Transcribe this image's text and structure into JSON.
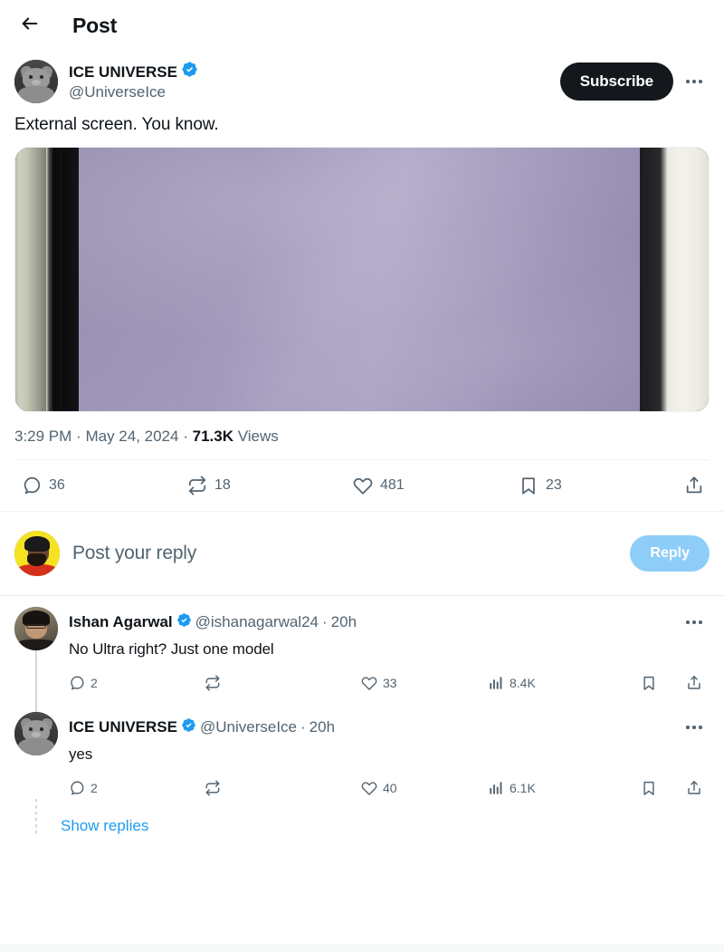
{
  "header": {
    "back_icon": "arrow-left-icon",
    "title": "Post"
  },
  "post": {
    "author": {
      "display_name": "ICE UNIVERSE",
      "handle": "@UniverseIce",
      "verified": true,
      "verified_badge_color": "#1D9BF0",
      "avatar": "cat-avatar"
    },
    "subscribe_label": "Subscribe",
    "more_icon": "more-horizontal-icon",
    "text": "External screen. You know.",
    "media": {
      "alt": "foldable-phone-external-screen",
      "screen_color": "#9f96ba",
      "body_color": "#eeede4"
    },
    "meta": {
      "time": "3:29 PM",
      "separator": "·",
      "date": "May 24, 2024",
      "views_count": "71.3K",
      "views_label": "Views"
    },
    "actions": {
      "reply_count": "36",
      "retweet_count": "18",
      "like_count": "481",
      "bookmark_count": "23",
      "share_icon": "share-icon"
    }
  },
  "composer": {
    "avatar": "man-avatar",
    "placeholder": "Post your reply",
    "reply_label": "Reply",
    "reply_button_color": "#8ECDF8"
  },
  "replies": [
    {
      "display_name": "Ishan Agarwal",
      "handle": "@ishanagarwal24",
      "dot": "·",
      "time": "20h",
      "verified": true,
      "avatar": "ishan-avatar",
      "text": "No Ultra right? Just one model",
      "more_icon": "more-horizontal-icon",
      "reply_count": "2",
      "retweet_count": "",
      "like_count": "33",
      "views_count": "8.4K"
    },
    {
      "display_name": "ICE UNIVERSE",
      "handle": "@UniverseIce",
      "dot": "·",
      "time": "20h",
      "verified": true,
      "avatar": "cat-avatar",
      "text": "yes",
      "more_icon": "more-horizontal-icon",
      "reply_count": "2",
      "retweet_count": "",
      "like_count": "40",
      "views_count": "6.1K"
    }
  ],
  "show_replies": {
    "label": "Show replies",
    "color": "#1D9BF0"
  }
}
